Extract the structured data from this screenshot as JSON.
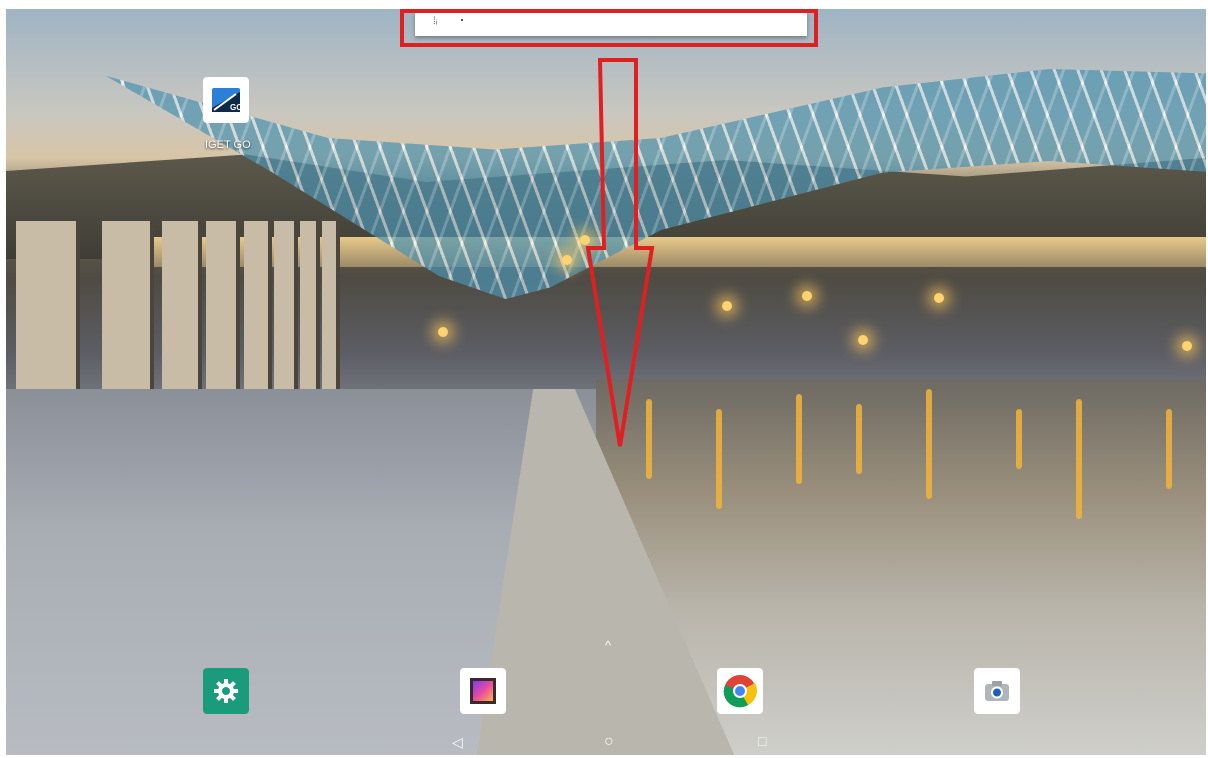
{
  "desktop": {
    "apps": [
      {
        "label": "IGET GO",
        "icon": "iget-go-app-icon"
      }
    ]
  },
  "dock": {
    "apps": [
      {
        "icon": "settings-gear-icon"
      },
      {
        "icon": "gallery-photo-icon"
      },
      {
        "icon": "chrome-browser-icon"
      },
      {
        "icon": "camera-app-icon"
      }
    ],
    "app_drawer_icon": "chevron-up-icon"
  },
  "navbar": {
    "buttons": [
      {
        "icon": "back-triangle-icon",
        "glyph": "◁"
      },
      {
        "icon": "home-circle-icon",
        "glyph": "○"
      },
      {
        "icon": "recents-square-icon",
        "glyph": "□"
      }
    ]
  },
  "annotation": {
    "box_color": "#e02020",
    "arrow_color": "#e02020"
  },
  "colors": {
    "settings_bg": "#1a9c7c",
    "white_tile": "#ffffff"
  }
}
